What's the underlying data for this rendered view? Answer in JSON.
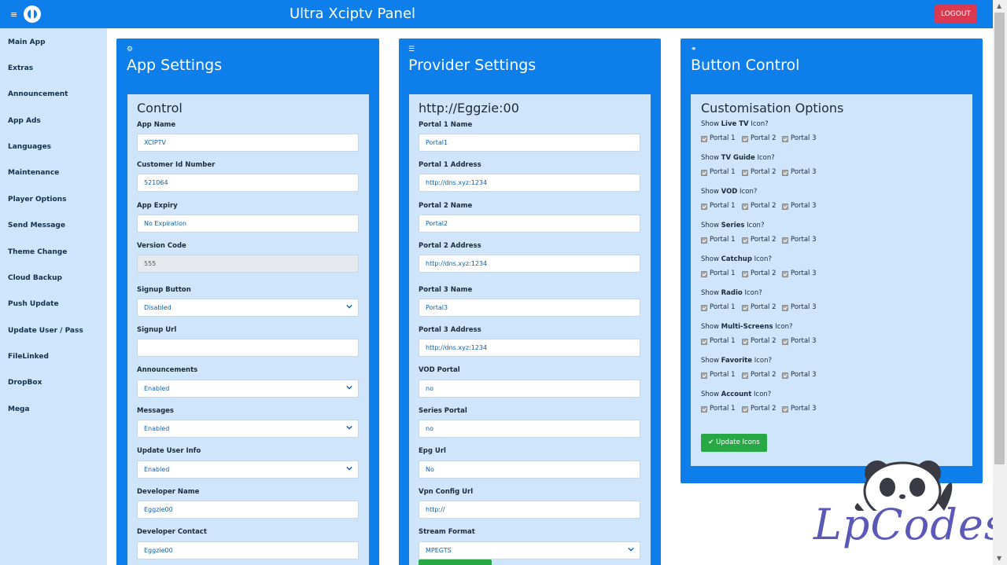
{
  "header": {
    "title": "Ultra Xciptv Panel",
    "logout_label": "LOGOUT",
    "menu_glyph": "≡"
  },
  "sidebar": {
    "items": [
      "Main App",
      "Extras",
      "Announcement",
      "App Ads",
      "Languages",
      "Maintenance",
      "Player Options",
      "Send Message",
      "Theme Change",
      "Cloud Backup",
      "Push Update",
      "Update User / Pass",
      "FileLinked",
      "DropBox",
      "Mega"
    ]
  },
  "panels": {
    "app_settings": {
      "title": "App Settings",
      "icon": "gears-icon",
      "section_title": "Control",
      "fields": [
        {
          "label": "App Name",
          "value": "XCIPTV",
          "type": "text"
        },
        {
          "label": "Customer Id Number",
          "value": "521064",
          "type": "text"
        },
        {
          "label": "App Expiry",
          "value": "No Expiration",
          "type": "text"
        },
        {
          "label": "Version Code",
          "value": "555",
          "type": "disabled"
        },
        {
          "label": "Signup Button",
          "value": "Disabled",
          "type": "select"
        },
        {
          "label": "Signup Url",
          "value": "",
          "type": "text"
        },
        {
          "label": "Announcements",
          "value": "Enabled",
          "type": "select"
        },
        {
          "label": "Messages",
          "value": "Enabled",
          "type": "select"
        },
        {
          "label": "Update User Info",
          "value": "Enabled",
          "type": "select"
        },
        {
          "label": "Developer Name",
          "value": "Eggzie00",
          "type": "text"
        },
        {
          "label": "Developer Contact",
          "value": "Eggzie00",
          "type": "text"
        }
      ]
    },
    "provider_settings": {
      "title": "Provider Settings",
      "icon": "list-icon",
      "section_title": "http://Eggzie:00",
      "fields": [
        {
          "label": "Portal 1 Name",
          "value": "Portal1",
          "type": "text"
        },
        {
          "label": "Portal 1 Address",
          "value": "http://dns.xyz:1234",
          "type": "text"
        },
        {
          "label": "Portal 2  Name",
          "value": "Portal2",
          "type": "text"
        },
        {
          "label": "Portal 2 Address",
          "value": "http://dns.xyz:1234",
          "type": "text"
        },
        {
          "label": "Portal 3  Name",
          "value": "Portal3",
          "type": "text"
        },
        {
          "label": "Portal 3 Address",
          "value": "http://dns.xyz:1234",
          "type": "text"
        },
        {
          "label": "VOD Portal",
          "value": "no",
          "type": "text"
        },
        {
          "label": "Series Portal",
          "value": "no",
          "type": "text"
        },
        {
          "label": "Epg Url",
          "value": "No",
          "type": "text"
        },
        {
          "label": "Vpn Config Url",
          "value": "http://",
          "type": "text"
        },
        {
          "label": "Stream Format",
          "value": "MPEGTS",
          "type": "select"
        }
      ]
    },
    "button_control": {
      "title": "Button Control",
      "icon": "link-icon",
      "section_title": "Customisation Options",
      "options": [
        {
          "prefix": "Show ",
          "name": "Live TV",
          "suffix": " Icon?"
        },
        {
          "prefix": "Show ",
          "name": "TV Guide",
          "suffix": " Icon?"
        },
        {
          "prefix": "Show ",
          "name": "VOD",
          "suffix": " Icon?"
        },
        {
          "prefix": "Show ",
          "name": "Series",
          "suffix": " Icon?"
        },
        {
          "prefix": "Show ",
          "name": "Catchup",
          "suffix": " Icon?"
        },
        {
          "prefix": "Show ",
          "name": "Radio",
          "suffix": " Icon?"
        },
        {
          "prefix": "Show ",
          "name": "Multi-Screens",
          "suffix": " Icon?"
        },
        {
          "prefix": "Show ",
          "name": "Favorite",
          "suffix": " Icon?"
        },
        {
          "prefix": "Show ",
          "name": "Account",
          "suffix": " Icon?"
        }
      ],
      "checkbox_labels": [
        "Portal 1",
        "Portal 2",
        "Portal 3"
      ],
      "update_label": "Update Icons"
    }
  },
  "watermark": {
    "text": "LpCodes"
  },
  "colors": {
    "primary": "#0d7eea",
    "panel_bg": "#cfe5fb",
    "danger": "#d93a4f",
    "success": "#28a745"
  }
}
